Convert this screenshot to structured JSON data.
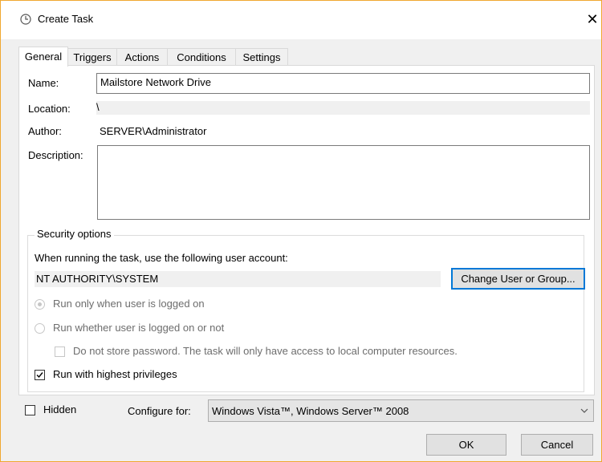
{
  "window": {
    "title": "Create Task",
    "close": "✕"
  },
  "tabs": [
    "General",
    "Triggers",
    "Actions",
    "Conditions",
    "Settings"
  ],
  "general": {
    "name_label": "Name:",
    "name_value": "Mailstore Network Drive",
    "location_label": "Location:",
    "location_value": "\\",
    "author_label": "Author:",
    "author_value": "SERVER\\Administrator",
    "description_label": "Description:",
    "description_value": ""
  },
  "security": {
    "legend": "Security options",
    "instruction": "When running the task, use the following user account:",
    "account": "NT AUTHORITY\\SYSTEM",
    "change_button": "Change User or Group...",
    "radio_logged_on": "Run only when user is logged on",
    "radio_whether": "Run whether user is logged on or not",
    "no_store_password": "Do not store password.  The task will only have access to local computer resources.",
    "highest_privileges": "Run with highest privileges"
  },
  "bottom": {
    "hidden_label": "Hidden",
    "configure_label": "Configure for:",
    "configure_value": "Windows Vista™, Windows Server™ 2008",
    "ok": "OK",
    "cancel": "Cancel"
  },
  "state": {
    "radio_logged_on_selected": true,
    "radio_enabled": false,
    "no_store_password_checked": false,
    "highest_privileges_checked": true,
    "hidden_checked": false,
    "active_tab": "General"
  },
  "colors": {
    "accent_border": "#f0a830",
    "focus_blue": "#0078d7"
  },
  "icons": {
    "title": "clock-icon",
    "close": "close-icon",
    "dropdown": "chevron-down-icon"
  }
}
